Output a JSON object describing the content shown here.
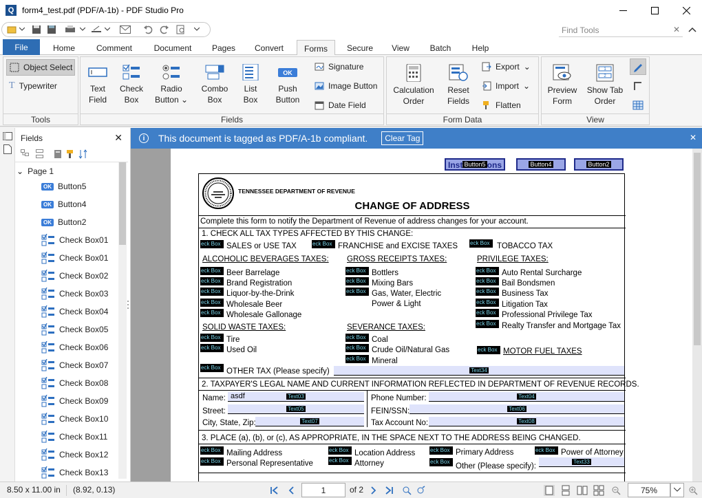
{
  "window": {
    "title": "form4_test.pdf (PDF/A-1b) - PDF Studio Pro",
    "app_letter": "Q"
  },
  "find_tools": {
    "placeholder": "Find Tools"
  },
  "menu_tabs": [
    "File",
    "Home",
    "Comment",
    "Document",
    "Pages",
    "Convert",
    "Forms",
    "Secure",
    "View",
    "Batch",
    "Help"
  ],
  "active_tab": "Forms",
  "ribbon": {
    "tools": {
      "label": "Tools",
      "object_select": "Object Select",
      "typewriter": "Typewriter"
    },
    "fields": {
      "label": "Fields",
      "text_field": [
        "Text",
        "Field"
      ],
      "check_box": [
        "Check",
        "Box"
      ],
      "radio_button": [
        "Radio",
        "Button"
      ],
      "combo_box": [
        "Combo",
        "Box"
      ],
      "list_box": [
        "List",
        "Box"
      ],
      "push_button": [
        "Push",
        "Button"
      ],
      "signature": "Signature",
      "image_button": "Image Button",
      "date_field": "Date Field"
    },
    "form_data": {
      "label": "Form Data",
      "calculation_order": [
        "Calculation",
        "Order"
      ],
      "reset_fields": [
        "Reset",
        "Fields"
      ],
      "export": "Export",
      "import": "Import",
      "flatten": "Flatten"
    },
    "view": {
      "label": "View",
      "preview_form": [
        "Preview",
        "Form"
      ],
      "show_tab_order": [
        "Show Tab",
        "Order"
      ]
    }
  },
  "fields_panel": {
    "title": "Fields",
    "page_node": "Page 1",
    "items": [
      {
        "type": "button",
        "label": "Button5"
      },
      {
        "type": "button",
        "label": "Button4"
      },
      {
        "type": "button",
        "label": "Button2"
      },
      {
        "type": "check",
        "label": "Check Box01"
      },
      {
        "type": "check",
        "label": "Check Box01"
      },
      {
        "type": "check",
        "label": "Check Box02"
      },
      {
        "type": "check",
        "label": "Check Box03"
      },
      {
        "type": "check",
        "label": "Check Box04"
      },
      {
        "type": "check",
        "label": "Check Box05"
      },
      {
        "type": "check",
        "label": "Check Box06"
      },
      {
        "type": "check",
        "label": "Check Box07"
      },
      {
        "type": "check",
        "label": "Check Box08"
      },
      {
        "type": "check",
        "label": "Check Box09"
      },
      {
        "type": "check",
        "label": "Check Box10"
      },
      {
        "type": "check",
        "label": "Check Box11"
      },
      {
        "type": "check",
        "label": "Check Box12"
      },
      {
        "type": "check",
        "label": "Check Box13"
      }
    ]
  },
  "infobar": {
    "message": "This document is tagged as PDF/A-1b compliant.",
    "clear_tag": "Clear Tag"
  },
  "document": {
    "top_buttons": {
      "b1_text": "Inst",
      "b1_text2": "ons",
      "b1_label": "Button5",
      "b2_label": "Button4",
      "b3_label": "Button2"
    },
    "department": "TENNESSEE DEPARTMENT OF REVENUE",
    "title": "CHANGE OF ADDRESS",
    "intro": "Complete this form to notify the Department of Revenue of address changes for your account.",
    "section1": "1.  CHECK ALL TAX TYPES AFFECTED BY THIS CHANGE:",
    "cb_label": "eck Box",
    "top_taxes": [
      "SALES or USE TAX",
      "FRANCHISE and EXCISE TAXES",
      "TOBACCO TAX"
    ],
    "alcohol": {
      "heading": "ALCOHOLIC BEVERAGES TAXES:",
      "items": [
        "Beer Barrelage",
        "Brand Registration",
        "Liquor-by-the-Drink",
        "Wholesale Beer",
        "Wholesale Gallonage"
      ]
    },
    "gross": {
      "heading": "GROSS RECEIPTS TAXES:",
      "items": [
        "Bottlers",
        "Mixing Bars",
        "Gas, Water, Electric",
        "Power & Light"
      ]
    },
    "privilege": {
      "heading": "PRIVILEGE TAXES:",
      "items": [
        "Auto Rental Surcharge",
        "Bail Bondsmen",
        "Business Tax",
        "Litigation Tax",
        "Professional Privilege Tax",
        "Realty Transfer and Mortgage Tax"
      ]
    },
    "solid": {
      "heading": "SOLID WASTE TAXES:",
      "items": [
        "Tire",
        "Used Oil"
      ]
    },
    "severance": {
      "heading": "SEVERANCE TAXES:",
      "items": [
        "Coal",
        "Crude Oil/Natural Gas",
        "Mineral"
      ]
    },
    "motor_fuel": "MOTOR FUEL TAXES",
    "other_tax": "OTHER TAX (Please specify)",
    "text34": "Text34",
    "section2": "2.  TAXPAYER'S LEGAL NAME AND CURRENT INFORMATION REFLECTED IN DEPARTMENT OF REVENUE RECORDS.",
    "name_label": "Name:",
    "name_value": "asdf",
    "street_label": "Street:",
    "city_label": "City, State, Zip:",
    "phone_label": "Phone Number:",
    "fein_label": "FEIN/SSN:",
    "taxacct_label": "Tax Account No:",
    "tf": {
      "t3": "Text03",
      "t4": "Text04",
      "t5": "Text05",
      "t6": "Text06",
      "t7": "Text07",
      "t8": "Text08",
      "t33": "Text33"
    },
    "section3": "3.  PLACE (a), (b), or (c), AS APPROPRIATE, IN THE SPACE NEXT TO THE ADDRESS BEING CHANGED.",
    "addr_types": [
      "Mailing Address",
      "Location Address",
      "Primary Address",
      "Power of Attorney",
      "Personal Representative",
      "Attorney",
      "Other (Please specify):"
    ]
  },
  "status": {
    "page_size": "8.50 x 11.00 in",
    "coords": "(8.92, 0.13)",
    "current_page": "1",
    "of_pages": "of 2",
    "zoom": "75%"
  },
  "colors": {
    "accent": "#2e6db4",
    "infobar": "#3f7fc8",
    "field_fill": "#dfe3fb"
  }
}
